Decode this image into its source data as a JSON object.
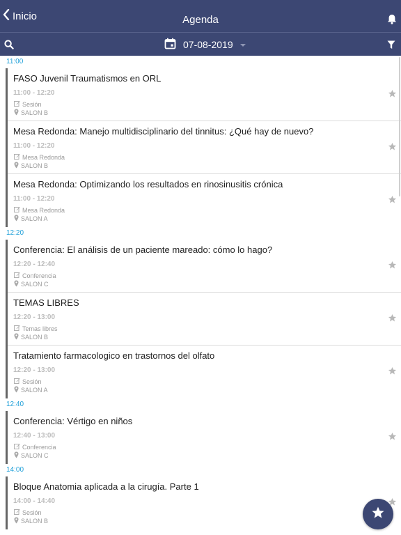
{
  "header": {
    "back_label": "Inicio",
    "title": "Agenda"
  },
  "toolbar": {
    "date": "07-08-2019"
  },
  "colors": {
    "navbar": "#3c4773",
    "time_header": "#1e9fd8",
    "session_bar": "#666666"
  },
  "icons": {
    "back": "chevron-left-icon",
    "bell": "bell-icon",
    "search": "search-icon",
    "calendar": "calendar-icon",
    "filter": "filter-icon",
    "type": "pencil-square-icon",
    "room": "map-pin-icon",
    "favorite": "star-icon"
  },
  "groups": [
    {
      "time": "11:00",
      "sessions": [
        {
          "title": "FASO Juvenil Traumatismos en ORL",
          "time": "11:00 - 12:20",
          "type": "Sesión",
          "room": "SALON B"
        },
        {
          "title": "Mesa Redonda: Manejo multidisciplinario del tinnitus: ¿Qué hay de nuevo?",
          "time": "11:00 - 12:20",
          "type": "Mesa Redonda",
          "room": "SALON B"
        },
        {
          "title": "Mesa Redonda: Optimizando los resultados en rinosinusitis crónica",
          "time": "11:00 - 12:20",
          "type": "Mesa Redonda",
          "room": "SALON A"
        }
      ]
    },
    {
      "time": "12:20",
      "sessions": [
        {
          "title": "Conferencia: El análisis de un paciente mareado: cómo lo hago?",
          "time": "12:20 - 12:40",
          "type": "Conferencia",
          "room": "SALON C"
        },
        {
          "title": "TEMAS LIBRES",
          "time": "12:20 - 13:00",
          "type": "Temas libres",
          "room": "SALON B"
        },
        {
          "title": "Tratamiento farmacologico en trastornos del olfato",
          "time": "12:20 - 13:00",
          "type": "Sesión",
          "room": "SALON A"
        }
      ]
    },
    {
      "time": "12:40",
      "sessions": [
        {
          "title": "Conferencia: Vértigo en niños",
          "time": "12:40 - 13:00",
          "type": "Conferencia",
          "room": "SALON C"
        }
      ]
    },
    {
      "time": "14:00",
      "sessions": [
        {
          "title": "Bloque Anatomia aplicada a la cirugía. Parte 1",
          "time": "14:00 - 14:40",
          "type": "Sesión",
          "room": "SALON B"
        }
      ]
    }
  ]
}
